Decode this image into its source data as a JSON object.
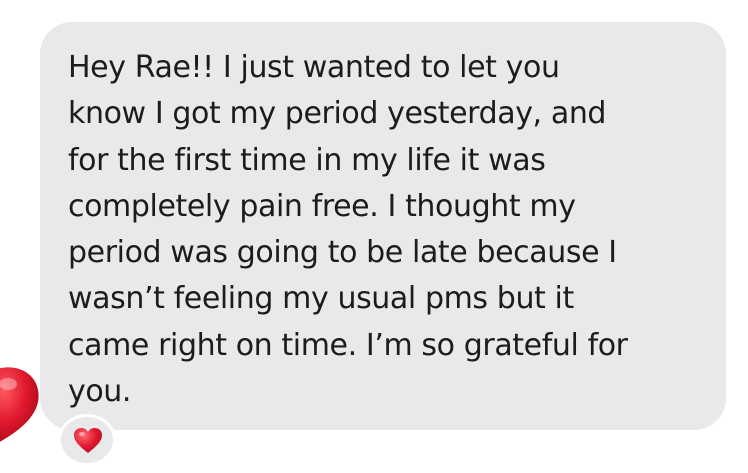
{
  "message": {
    "lines": [
      "Hey Rae!! I just wanted to let you",
      "know I got my period yesterday, and",
      "for the first time in my life it was",
      "completely pain free. I thought my",
      "period was going to be late because I",
      "wasn’t feeling my usual pms but it",
      "came right on time. I’m so grateful for",
      "you."
    ],
    "bubble_color": "#e9e9eb",
    "text_color": "#1c1c1e"
  },
  "reaction": {
    "icon": "red-heart-icon",
    "color": "#e0182d"
  },
  "decoration": {
    "icon": "red-heart-icon",
    "color": "#e0182d"
  }
}
